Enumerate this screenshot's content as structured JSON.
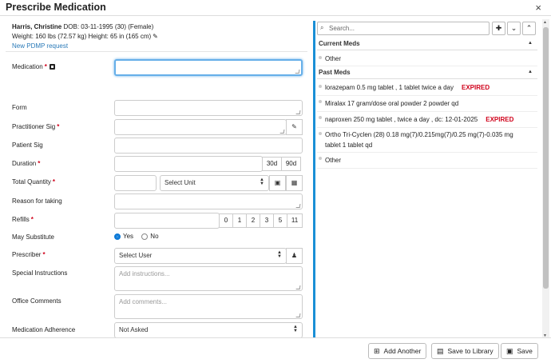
{
  "window": {
    "title": "Prescribe Medication",
    "close_icon": "×"
  },
  "patient": {
    "name": "Harris, Christine",
    "dob": "DOB: 03-11-1995 (30) (Female)",
    "vitals": "Weight: 160 lbs (72.57 kg)  Height: 65 in (165 cm)",
    "pdmp_link": "New PDMP request"
  },
  "form": {
    "medication_label": "Medication",
    "form_label": "Form",
    "practitioner_sig_label": "Practitioner Sig",
    "patient_sig_label": "Patient Sig",
    "duration_label": "Duration",
    "duration_opts": [
      "30d",
      "90d"
    ],
    "total_quantity_label": "Total Quantity",
    "unit_placeholder": "Select Unit",
    "reason_label": "Reason for taking",
    "refills_label": "Refills",
    "refill_opts": [
      "0",
      "1",
      "2",
      "3",
      "5",
      "11"
    ],
    "may_substitute_label": "May Substitute",
    "yes_label": "Yes",
    "no_label": "No",
    "prescriber_label": "Prescriber",
    "prescriber_placeholder": "Select User",
    "special_instructions_label": "Special Instructions",
    "special_instructions_placeholder": "Add instructions...",
    "office_comments_label": "Office Comments",
    "office_comments_placeholder": "Add comments...",
    "adherence_label": "Medication Adherence",
    "adherence_value": "Not Asked",
    "required_marker": "*"
  },
  "meds_panel": {
    "search_placeholder": "Search...",
    "current_meds_header": "Current Meds",
    "current_meds": [
      "Other"
    ],
    "past_meds_header": "Past Meds",
    "past_meds": [
      {
        "text": "lorazepam 0.5 mg tablet , 1 tablet twice a day",
        "badge": "EXPIRED"
      },
      {
        "text": "Miralax 17 gram/dose oral powder 2 powder qd",
        "badge": ""
      },
      {
        "text": "naproxen 250 mg tablet , twice a day , dc: 12-01-2025",
        "badge": "EXPIRED"
      },
      {
        "text": "Ortho Tri-Cyclen (28) 0.18 mg(7)/0.215mg(7)/0.25 mg(7)-0.035 mg",
        "text2": "tablet 1 tablet qd",
        "badge": ""
      },
      {
        "text": "Other",
        "badge": ""
      }
    ]
  },
  "footer": {
    "add_another": "Add Another",
    "save_to_library": "Save to Library",
    "save": "Save"
  }
}
